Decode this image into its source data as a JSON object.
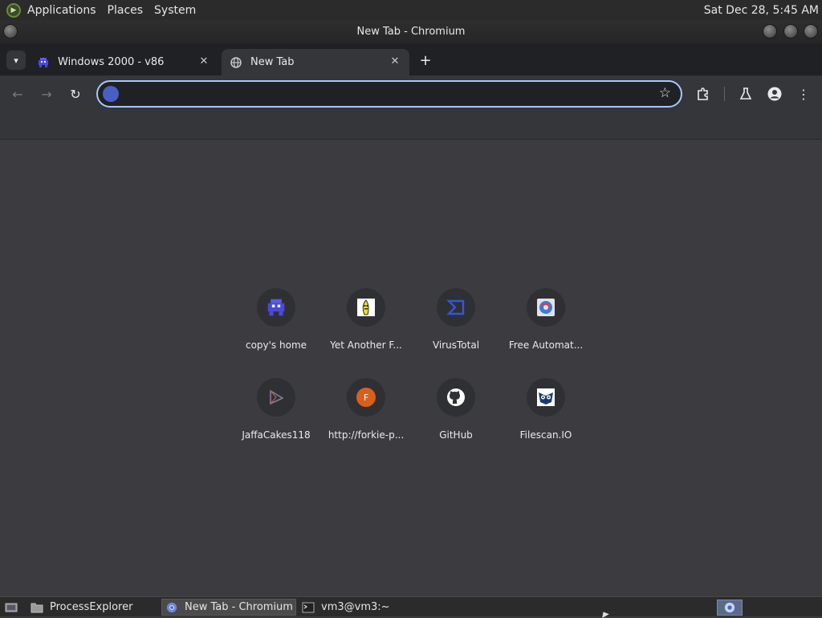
{
  "system_bar": {
    "menus": [
      "Applications",
      "Places",
      "System"
    ],
    "clock": "Sat Dec 28,  5:45 AM"
  },
  "window": {
    "title": "New Tab - Chromium"
  },
  "tabs": [
    {
      "label": "Windows 2000 - v86",
      "active": false
    },
    {
      "label": "New Tab",
      "active": true
    }
  ],
  "omnibox": {
    "value": "",
    "placeholder": ""
  },
  "shortcuts": [
    {
      "label": "copy's home",
      "icon": "pixel-alien-icon",
      "color": "#4a4ad8"
    },
    {
      "label": "Yet Another F...",
      "icon": "banana-icon",
      "color": "#f0e020"
    },
    {
      "label": "VirusTotal",
      "icon": "virustotal-sigma-icon",
      "color": "#3355dd"
    },
    {
      "label": "Free Automat...",
      "icon": "globe-icon",
      "color": "#e04040"
    },
    {
      "label": "JaffaCakes118",
      "icon": "play-triangle-icon",
      "color": "#7a6a8a"
    },
    {
      "label": "http://forkie-p...",
      "icon": "letter-f-icon",
      "letter": "F",
      "color": "#d9601a"
    },
    {
      "label": "GitHub",
      "icon": "github-icon",
      "color": "#ffffff"
    },
    {
      "label": "Filescan.IO",
      "icon": "owl-icon",
      "color": "#1a3a6a"
    }
  ],
  "taskbar": {
    "items": [
      {
        "label": "ProcessExplorer",
        "icon": "folder-icon",
        "active": false
      },
      {
        "label": "New Tab - Chromium",
        "icon": "chromium-icon",
        "active": true
      },
      {
        "label": "vm3@vm3:~",
        "icon": "terminal-icon",
        "active": false
      }
    ]
  },
  "colors": {
    "accent_focus": "#a8c7fa",
    "content_bg": "#3c3c40",
    "toolbar_bg": "#35363a",
    "tabstrip_bg": "#202124"
  }
}
